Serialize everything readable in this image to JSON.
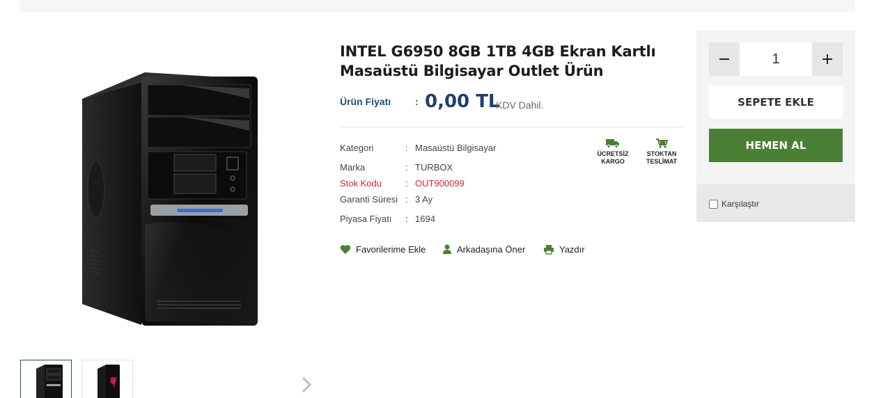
{
  "product": {
    "title_line1": "INTEL G6950 8GB 1TB 4GB Ekran Kartlı",
    "title_line2": "Masaüstü Bilgisayar Outlet Ürün",
    "price_label": "Ürün Fiyatı",
    "price_value": "0,00 TL",
    "price_vat": "KDV Dahil."
  },
  "specs": [
    {
      "key": "Kategori",
      "value": "Masaüstü Bilgisayar"
    },
    {
      "key": "Marka",
      "value": "TURBOX"
    },
    {
      "key": "Stok Kodu",
      "value": "OUT900099"
    },
    {
      "key": "Garanti Süresi",
      "value": "3 Ay"
    },
    {
      "key": "Piyasa Fiyatı",
      "value": "1694"
    }
  ],
  "spec_colon": ":",
  "badges": {
    "free_shipping_1": "ÜCRETSİZ",
    "free_shipping_2": "KARGO",
    "stock_1": "STOKTAN",
    "stock_2": "TESLİMAT"
  },
  "actions": {
    "favorites": "Favorilerime Ekle",
    "recommend": "Arkadaşına Öner",
    "print": "Yazdır"
  },
  "cart": {
    "quantity": "1",
    "add_to_cart": "SEPETE EKLE",
    "buy_now": "HEMEN AL",
    "compare": "Karşılaştır"
  },
  "icons": {
    "favorites": "heart-icon",
    "recommend": "user-icon",
    "print": "printer-icon",
    "shipping": "truck-icon",
    "stock": "cart-icon"
  },
  "colors": {
    "price": "#1f3e70",
    "label_blue": "#1f4e79",
    "buy_button": "#4a7f35",
    "stock_code_red": "#d9232e",
    "icon_green": "#4a7f35"
  }
}
